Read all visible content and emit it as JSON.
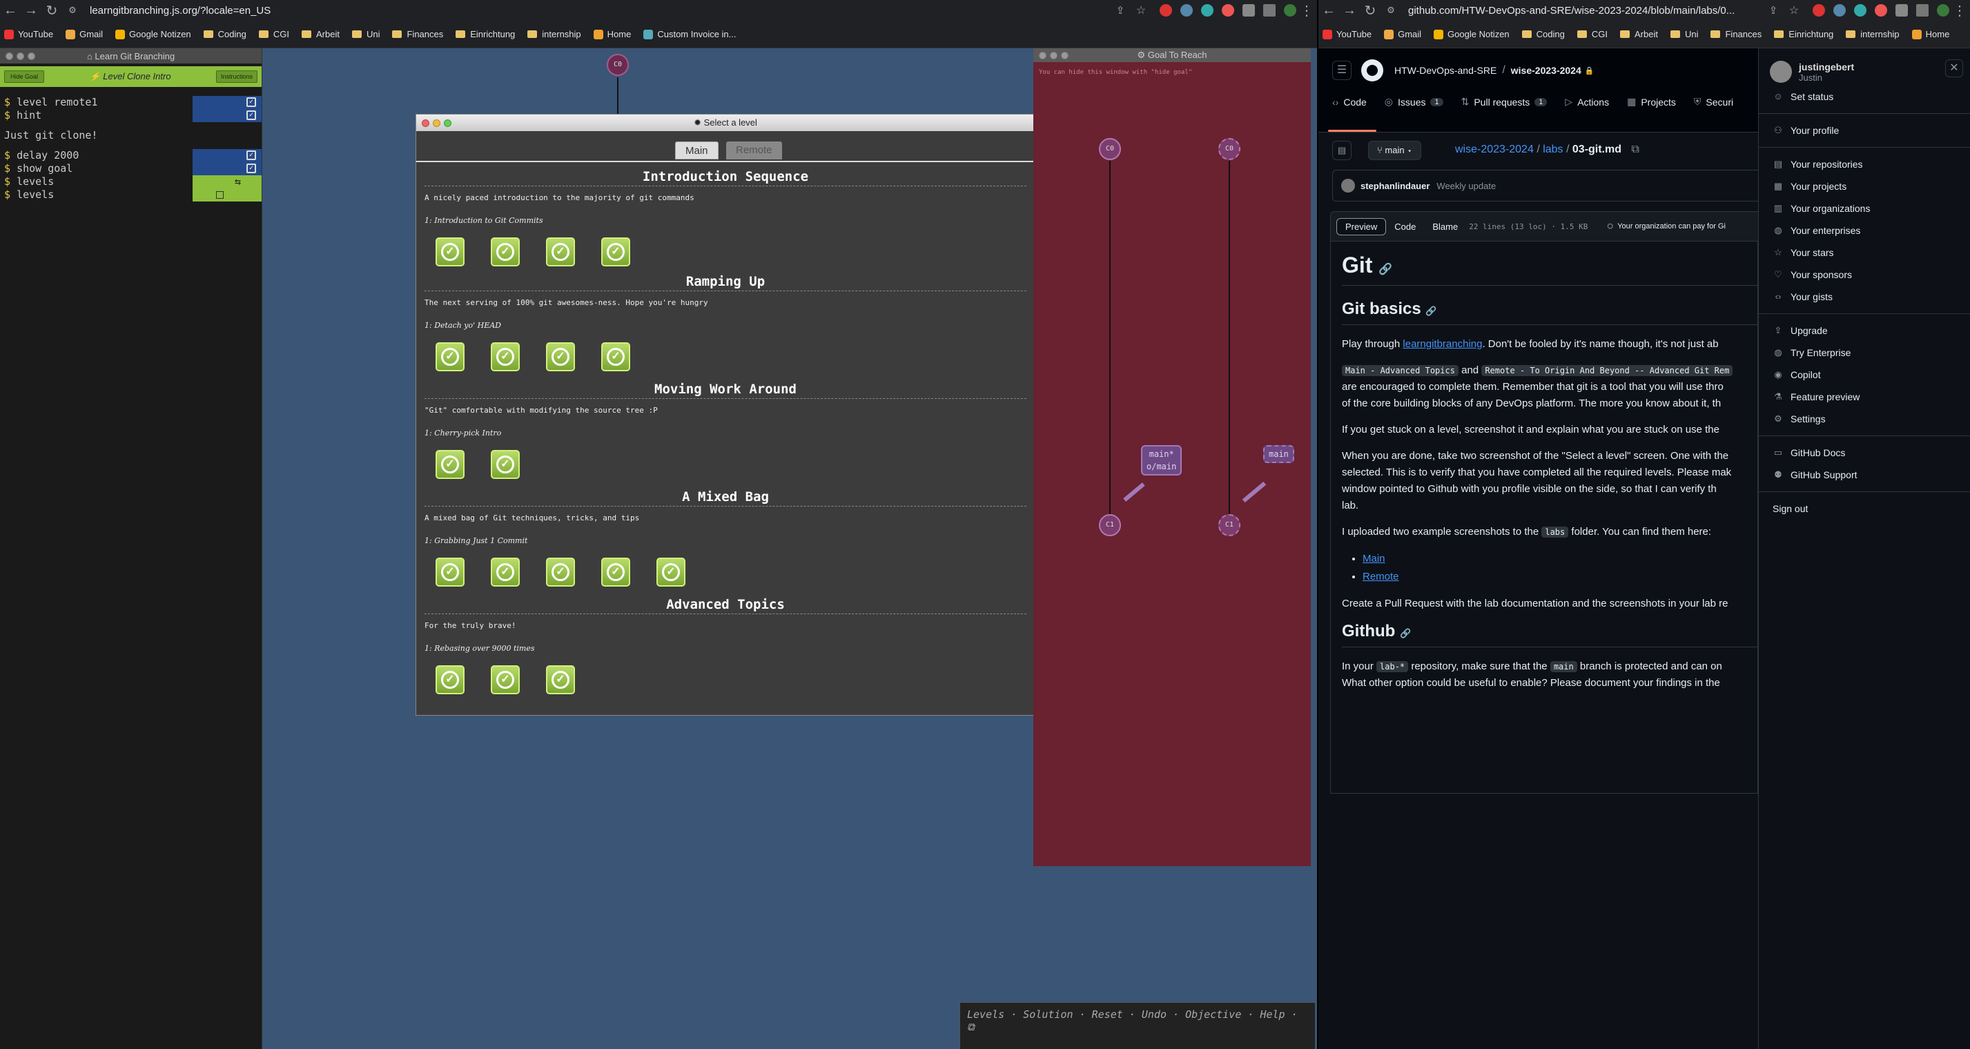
{
  "left_browser": {
    "url": "learngitbranching.js.org/?locale=en_US",
    "bookmarks": [
      "YouTube",
      "Gmail",
      "Google Notizen",
      "Coding",
      "CGI",
      "Arbeit",
      "Uni",
      "Finances",
      "Einrichtung",
      "internship",
      "Home",
      "Custom Invoice in..."
    ]
  },
  "right_browser": {
    "url": "github.com/HTW-DevOps-and-SRE/wise-2023-2024/blob/main/labs/0...",
    "bookmarks": [
      "YouTube",
      "Gmail",
      "Google Notizen",
      "Coding",
      "CGI",
      "Arbeit",
      "Uni",
      "Finances",
      "Einrichtung",
      "internship",
      "Home"
    ]
  },
  "lgb": {
    "panel_title": "Learn Git Branching",
    "hide_goal": "Hide Goal",
    "level_label": "Level Clone Intro",
    "instructions": "Instructions",
    "commands": [
      "level remote1",
      "hint"
    ],
    "output": "Just git clone!",
    "commands2": [
      "delay 2000",
      "show goal",
      "levels",
      "levels"
    ],
    "dialog_title": "Select a level",
    "tabs": [
      "Main",
      "Remote"
    ],
    "sections": [
      {
        "title": "Introduction Sequence",
        "desc": "A nicely paced introduction to the majority of git commands",
        "sub": "1: Introduction to Git Commits",
        "count": 4
      },
      {
        "title": "Ramping Up",
        "desc": "The next serving of 100% git awesomes-ness. Hope you're hungry",
        "sub": "1: Detach yo' HEAD",
        "count": 4
      },
      {
        "title": "Moving Work Around",
        "desc": "\"Git\" comfortable with modifying the source tree :P",
        "sub": "1: Cherry-pick Intro",
        "count": 2
      },
      {
        "title": "A Mixed Bag",
        "desc": "A mixed bag of Git techniques, tricks, and tips",
        "sub": "1: Grabbing Just 1 Commit",
        "count": 5
      },
      {
        "title": "Advanced Topics",
        "desc": "For the truly brave!",
        "sub": "1: Rebasing over 9000 times",
        "count": 3
      }
    ],
    "goal_title": "Goal To Reach",
    "goal_hint": "You can hide this window with \"hide goal\"",
    "nodes": {
      "c0": "C0",
      "c1": "C1"
    },
    "branch_local": [
      "main*",
      "o/main"
    ],
    "branch_remote": "main",
    "cmdbar": "Levels · Solution · Reset · Undo · Objective · Help ·"
  },
  "github": {
    "org": "HTW-DevOps-and-SRE",
    "repo": "wise-2023-2024",
    "tabs": [
      {
        "label": "Code"
      },
      {
        "label": "Issues",
        "count": "1"
      },
      {
        "label": "Pull requests",
        "count": "1"
      },
      {
        "label": "Actions"
      },
      {
        "label": "Projects"
      },
      {
        "label": "Securi"
      }
    ],
    "branch": "main",
    "path": [
      "wise-2023-2024",
      "labs",
      "03-git.md"
    ],
    "commit_user": "stephanlindauer",
    "commit_msg": "Weekly update",
    "view_tabs": [
      "Preview",
      "Code",
      "Blame"
    ],
    "file_info": "22 lines (13 loc) · 1.5 KB",
    "org_pay": "Your organization can pay for Gi",
    "h1": "Git",
    "h2a": "Git basics",
    "p1_pre": "Play through ",
    "p1_link": "learngitbranching",
    "p1_post": ". Don't be fooled by it's name though, it's not just ab",
    "p2_code1": "Main - Advanced Topics",
    "p2_and": " and ",
    "p2_code2": "Remote - To Origin And Beyond -- Advanced Git Rem",
    "p2_line2": "are encouraged to complete them. Remember that git is a tool that you will use thro",
    "p2_line3": "of the core building blocks of any DevOps platform. The more you know about it, th",
    "p3": "If you get stuck on a level, screenshot it and explain what you are stuck on use the",
    "p4_1": "When you are done, take two screenshot of the \"Select a level\" screen. One with the",
    "p4_2": "selected. This is to verify that you have completed all the required levels. Please mak",
    "p4_3": "window pointed to Github with you profile visible on the side, so that I can verify th",
    "p4_4": "lab.",
    "p5_pre": "I uploaded two example screenshots to the ",
    "p5_code": "labs",
    "p5_post": " folder. You can find them here:",
    "links": [
      "Main",
      "Remote"
    ],
    "p6": "Create a Pull Request with the lab documentation and the screenshots in your lab re",
    "h2b": "Github",
    "p7_pre": "In your ",
    "p7_code": "lab-*",
    "p7_mid": " repository, make sure that the ",
    "p7_code2": "main",
    "p7_post": " branch is protected and can on",
    "p7_line2": "What other option could be useful to enable? Please document your findings in the"
  },
  "user_menu": {
    "username": "justingebert",
    "name": "Justin",
    "items1": [
      {
        "icon": "smiley-icon",
        "label": "Set status"
      }
    ],
    "items2": [
      {
        "icon": "person-icon",
        "label": "Your profile"
      }
    ],
    "items3": [
      {
        "icon": "repo-icon",
        "label": "Your repositories"
      },
      {
        "icon": "project-icon",
        "label": "Your projects"
      },
      {
        "icon": "org-icon",
        "label": "Your organizations"
      },
      {
        "icon": "globe-icon",
        "label": "Your enterprises"
      },
      {
        "icon": "star-icon",
        "label": "Your stars"
      },
      {
        "icon": "heart-icon",
        "label": "Your sponsors"
      },
      {
        "icon": "gist-icon",
        "label": "Your gists"
      }
    ],
    "items4": [
      {
        "icon": "upload-icon",
        "label": "Upgrade"
      },
      {
        "icon": "globe-icon",
        "label": "Try Enterprise"
      },
      {
        "icon": "copilot-icon",
        "label": "Copilot"
      },
      {
        "icon": "beaker-icon",
        "label": "Feature preview"
      },
      {
        "icon": "gear-icon",
        "label": "Settings"
      }
    ],
    "items5": [
      {
        "icon": "book-icon",
        "label": "GitHub Docs"
      },
      {
        "icon": "people-icon",
        "label": "GitHub Support"
      }
    ],
    "signout": "Sign out"
  }
}
